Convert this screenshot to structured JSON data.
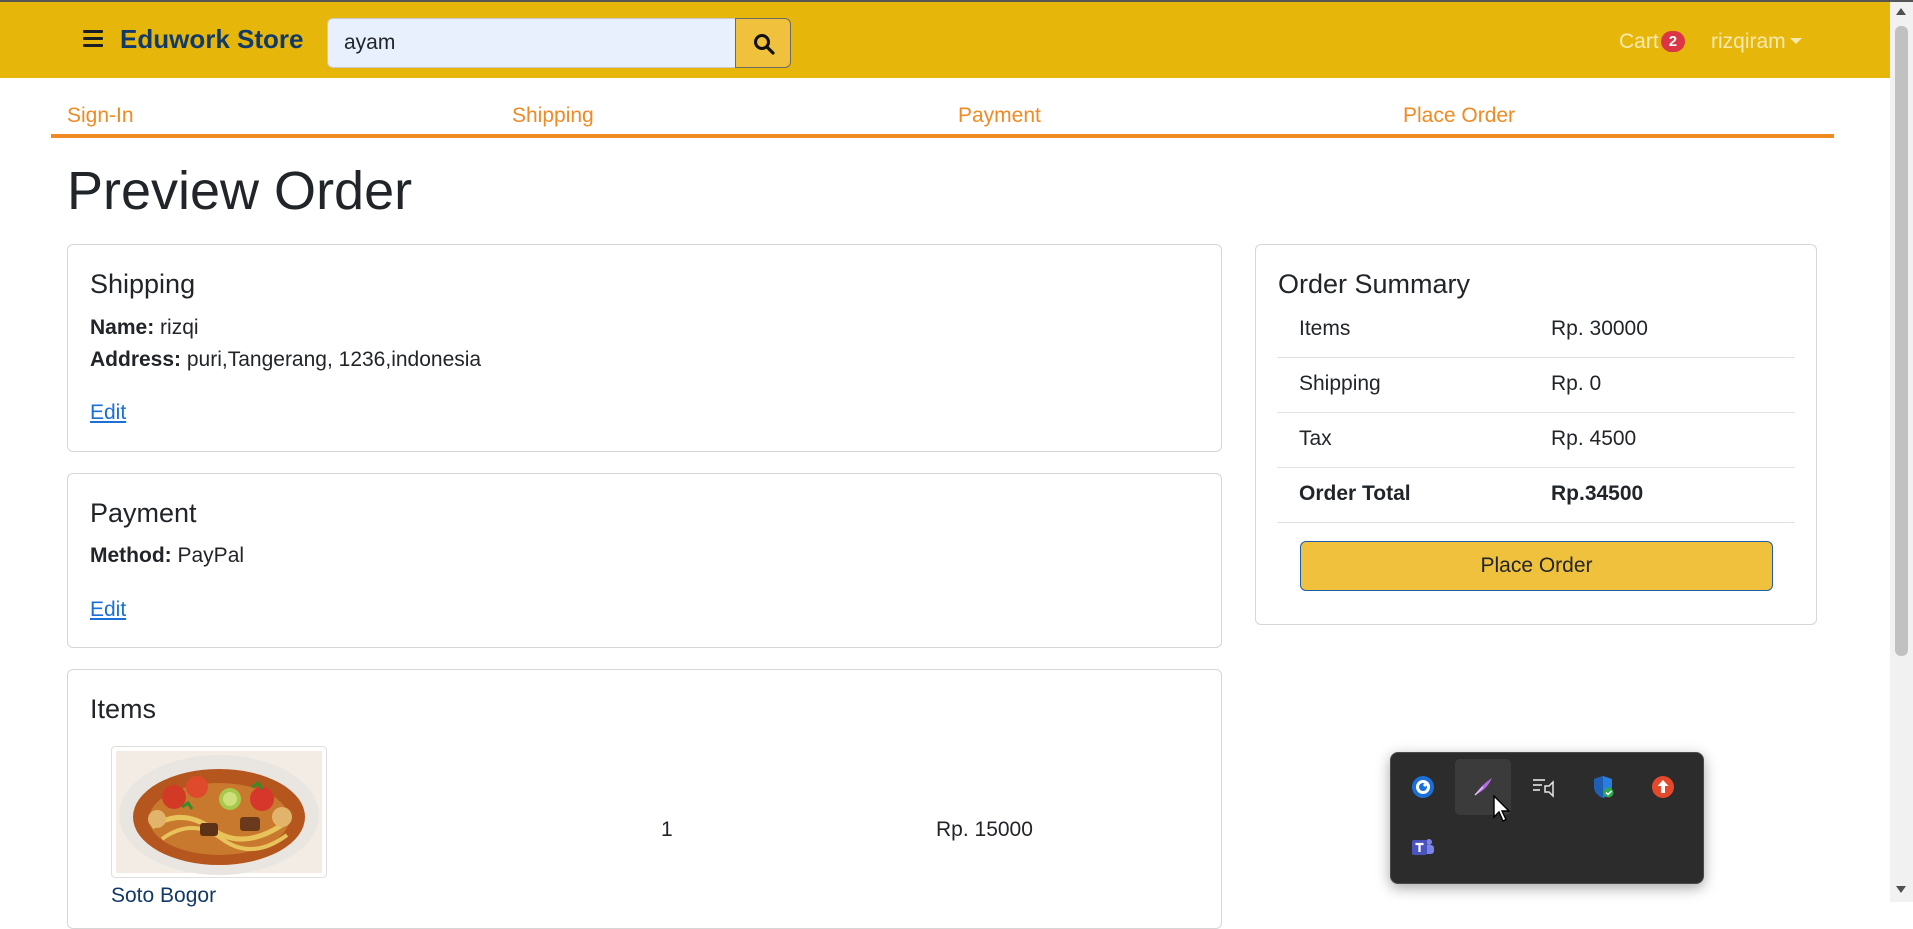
{
  "navbar": {
    "brand": "Eduwork Store",
    "search_value": "ayam",
    "cart_label": "Cart",
    "cart_count": "2",
    "user": "rizqiram"
  },
  "steps": [
    "Sign-In",
    "Shipping",
    "Payment",
    "Place Order"
  ],
  "page_title": "Preview Order",
  "shipping": {
    "heading": "Shipping",
    "name_label": "Name:",
    "name_value": "rizqi",
    "address_label": "Address:",
    "address_value": "puri,Tangerang, 1236,indonesia",
    "edit_label": "Edit"
  },
  "payment": {
    "heading": "Payment",
    "method_label": "Method:",
    "method_value": "PayPal",
    "edit_label": "Edit"
  },
  "items": {
    "heading": "Items",
    "rows": [
      {
        "name": "Soto Bogor",
        "quantity": "1",
        "price": "Rp. 15000"
      }
    ]
  },
  "summary": {
    "heading": "Order Summary",
    "rows": [
      {
        "label": "Items",
        "value": "Rp. 30000"
      },
      {
        "label": "Shipping",
        "value": "Rp. 0"
      },
      {
        "label": "Tax",
        "value": "Rp. 4500"
      },
      {
        "label": "Order Total",
        "value": "Rp.34500"
      }
    ],
    "button_label": "Place Order"
  },
  "tray_icons": [
    "steam-icon",
    "pen-icon",
    "audio-output-icon",
    "windows-security-icon",
    "update-icon",
    "teams-icon"
  ],
  "colors": {
    "navbar": "#e6b70a",
    "brand": "#123a69",
    "accent_orange": "#f08a24",
    "button_yellow": "#f0c13c",
    "link_blue": "#1a6fd8",
    "badge_red": "#dc3545"
  }
}
